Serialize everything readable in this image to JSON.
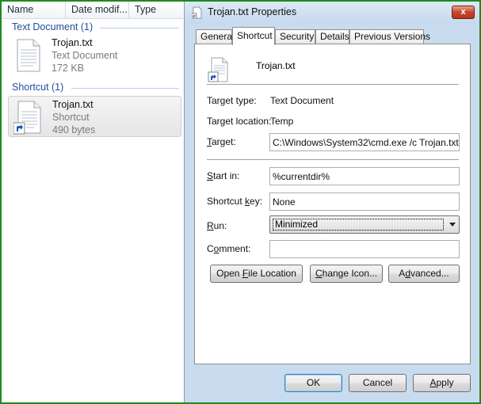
{
  "explorer": {
    "columns": [
      "Name",
      "Date modif...",
      "Type"
    ],
    "groups": [
      {
        "title": "Text Document (1)",
        "item": {
          "name": "Trojan.txt",
          "type": "Text Document",
          "size": "172 KB"
        }
      },
      {
        "title": "Shortcut (1)",
        "item": {
          "name": "Trojan.txt",
          "type": "Shortcut",
          "size": "490 bytes"
        }
      }
    ]
  },
  "dialog": {
    "title": "Trojan.txt Properties",
    "close_label": "x",
    "tabs": [
      "General",
      "Shortcut",
      "Security",
      "Details",
      "Previous Versions"
    ],
    "active_tab": "Shortcut",
    "file_name": "Trojan.txt",
    "target_type": {
      "label": "Target type:",
      "value": "Text Document"
    },
    "target_location": {
      "label": "Target location:",
      "value": "Temp"
    },
    "target": {
      "label_pre": "",
      "label_key": "T",
      "label_post": "arget:",
      "value": "C:\\Windows\\System32\\cmd.exe /c Trojan.txt"
    },
    "start_in": {
      "label_pre": "",
      "label_key": "S",
      "label_post": "tart in:",
      "value": "%currentdir%"
    },
    "shortcut_key": {
      "label_pre": "Shortcut ",
      "label_key": "k",
      "label_post": "ey:",
      "value": "None"
    },
    "run": {
      "label_pre": "",
      "label_key": "R",
      "label_post": "un:",
      "value": "Minimized"
    },
    "comment": {
      "label_pre": "C",
      "label_key": "o",
      "label_post": "mment:",
      "value": ""
    },
    "buttons": {
      "open_file_location": {
        "pre": "Open ",
        "key": "F",
        "post": "ile Location"
      },
      "change_icon": {
        "pre": "",
        "key": "C",
        "post": "hange Icon..."
      },
      "advanced": {
        "pre": "A",
        "key": "d",
        "post": "vanced..."
      }
    },
    "footer": {
      "ok": {
        "pre": "OK",
        "key": "",
        "post": ""
      },
      "cancel": {
        "pre": "Cancel",
        "key": "",
        "post": ""
      },
      "apply": {
        "pre": "",
        "key": "A",
        "post": "pply"
      }
    },
    "colors": {
      "accent": "#1f4f9a",
      "frame": "#1e8a1e",
      "close": "#c8452a"
    }
  }
}
